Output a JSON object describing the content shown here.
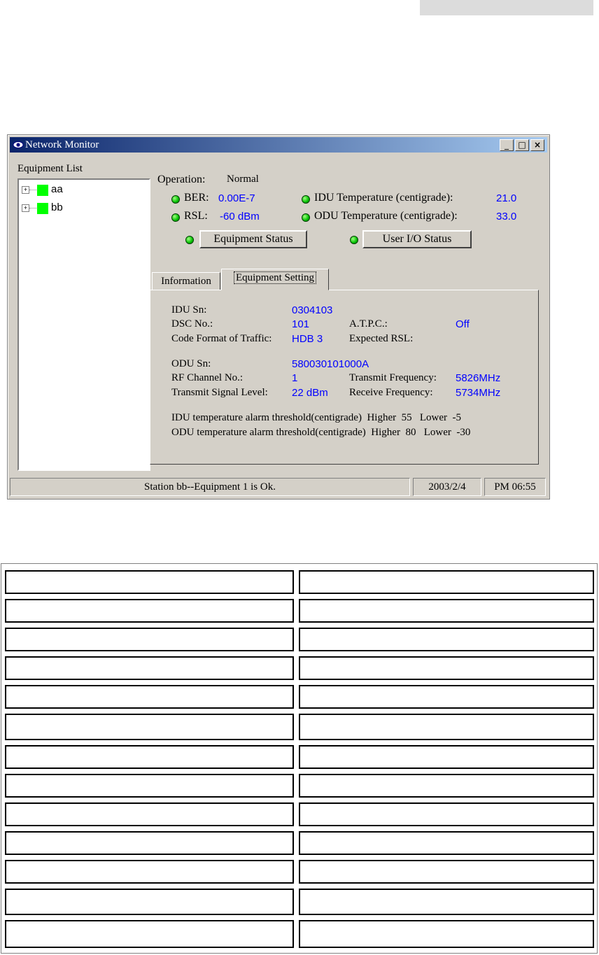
{
  "window": {
    "title": "Network Monitor",
    "buttons": {
      "minimize": "_",
      "maximize": "□",
      "close": "×"
    }
  },
  "equipment_list": {
    "label": "Equipment List",
    "items": [
      {
        "label": "aa",
        "status_color": "#00ff00"
      },
      {
        "label": "bb",
        "status_color": "#00ff00"
      }
    ]
  },
  "status": {
    "operation_label": "Operation:",
    "operation_value": "Normal",
    "ber_label": "BER:",
    "ber_value": "0.00E-7",
    "rsl_label": "RSL:",
    "rsl_value": "-60 dBm",
    "idu_temp_label": "IDU Temperature (centigrade):",
    "idu_temp_value": "21.0",
    "odu_temp_label": "ODU Temperature (centigrade):",
    "odu_temp_value": "33.0",
    "equipment_status_button": "Equipment Status",
    "user_io_status_button": "User I/O Status"
  },
  "tabs": [
    {
      "label": "Information",
      "active": false
    },
    {
      "label": "Equipment Setting",
      "active": true
    }
  ],
  "settings": {
    "idu_sn_label": "IDU Sn:",
    "idu_sn_value": "0304103",
    "dsc_label": "DSC No.:",
    "dsc_value": "101",
    "atpc_label": "A.T.P.C.:",
    "atpc_value": "Off",
    "code_format_label": "Code Format of Traffic:",
    "code_format_value": "HDB 3",
    "expected_rsl_label": "Expected RSL:",
    "odu_sn_label": "ODU Sn:",
    "odu_sn_value": "580030101000A",
    "rf_channel_label": "RF Channel No.:",
    "rf_channel_value": "1",
    "tx_freq_label": "Transmit Frequency:",
    "tx_freq_value": "5826MHz",
    "tx_level_label": "Transmit Signal Level:",
    "tx_level_value": "22 dBm",
    "rx_freq_label": "Receive Frequency:",
    "rx_freq_value": "5734MHz",
    "idu_alarm_text": "IDU temperature alarm threshold(centigrade)  Higher  55   Lower  -5",
    "odu_alarm_text": "ODU temperature alarm threshold(centigrade)  Higher  80   Lower  -30"
  },
  "statusbar": {
    "message": "Station bb--Equipment 1 is Ok.",
    "date": "2003/2/4",
    "time": "PM 06:55"
  },
  "accent_colors": {
    "titlebar_start": "#0a246a",
    "value_blue": "#0000ff",
    "led_green": "#00c000"
  }
}
